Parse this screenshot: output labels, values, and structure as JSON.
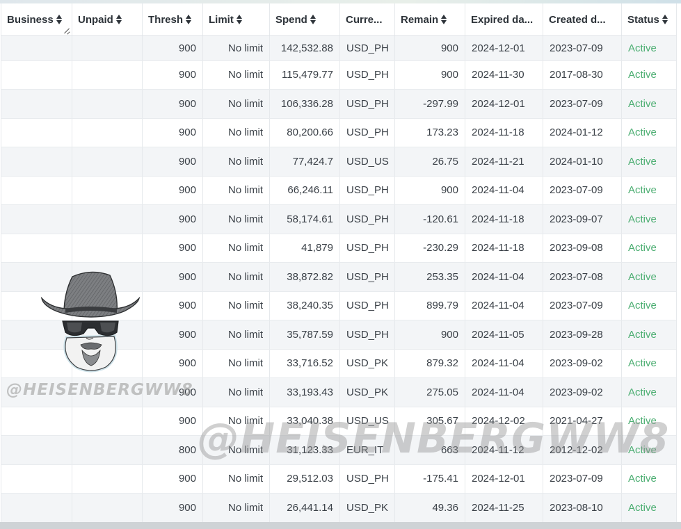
{
  "columns": [
    {
      "label": "Business",
      "name": "business"
    },
    {
      "label": "Unpaid",
      "name": "unpaid"
    },
    {
      "label": "Thresh",
      "name": "thresh"
    },
    {
      "label": "Limit",
      "name": "limit"
    },
    {
      "label": "Spend",
      "name": "spend"
    },
    {
      "label": "Curre...",
      "name": "currency"
    },
    {
      "label": "Remain",
      "name": "remain"
    },
    {
      "label": "Expired da...",
      "name": "expired-date"
    },
    {
      "label": "Created d...",
      "name": "created-date"
    },
    {
      "label": "Status",
      "name": "status"
    }
  ],
  "rows": [
    {
      "business": "",
      "unpaid": "",
      "thresh": "900",
      "limit": "No limit",
      "spend": "142,532.88",
      "currency": "USD_PH",
      "remain": "900",
      "expired": "2024-12-01",
      "created": "2023-07-09",
      "status": "Active"
    },
    {
      "business": "",
      "unpaid": "",
      "thresh": "900",
      "limit": "No limit",
      "spend": "115,479.77",
      "currency": "USD_PH",
      "remain": "900",
      "expired": "2024-11-30",
      "created": "2017-08-30",
      "status": "Active"
    },
    {
      "business": "",
      "unpaid": "",
      "thresh": "900",
      "limit": "No limit",
      "spend": "106,336.28",
      "currency": "USD_PH",
      "remain": "-297.99",
      "expired": "2024-12-01",
      "created": "2023-07-09",
      "status": "Active"
    },
    {
      "business": "",
      "unpaid": "",
      "thresh": "900",
      "limit": "No limit",
      "spend": "80,200.66",
      "currency": "USD_PH",
      "remain": "173.23",
      "expired": "2024-11-18",
      "created": "2024-01-12",
      "status": "Active"
    },
    {
      "business": "",
      "unpaid": "",
      "thresh": "900",
      "limit": "No limit",
      "spend": "77,424.7",
      "currency": "USD_US",
      "remain": "26.75",
      "expired": "2024-11-21",
      "created": "2024-01-10",
      "status": "Active"
    },
    {
      "business": "",
      "unpaid": "",
      "thresh": "900",
      "limit": "No limit",
      "spend": "66,246.11",
      "currency": "USD_PH",
      "remain": "900",
      "expired": "2024-11-04",
      "created": "2023-07-09",
      "status": "Active"
    },
    {
      "business": "",
      "unpaid": "",
      "thresh": "900",
      "limit": "No limit",
      "spend": "58,174.61",
      "currency": "USD_PH",
      "remain": "-120.61",
      "expired": "2024-11-18",
      "created": "2023-09-07",
      "status": "Active"
    },
    {
      "business": "",
      "unpaid": "",
      "thresh": "900",
      "limit": "No limit",
      "spend": "41,879",
      "currency": "USD_PH",
      "remain": "-230.29",
      "expired": "2024-11-18",
      "created": "2023-09-08",
      "status": "Active"
    },
    {
      "business": "",
      "unpaid": "",
      "thresh": "900",
      "limit": "No limit",
      "spend": "38,872.82",
      "currency": "USD_PH",
      "remain": "253.35",
      "expired": "2024-11-04",
      "created": "2023-07-08",
      "status": "Active"
    },
    {
      "business": "",
      "unpaid": "",
      "thresh": "900",
      "limit": "No limit",
      "spend": "38,240.35",
      "currency": "USD_PH",
      "remain": "899.79",
      "expired": "2024-11-04",
      "created": "2023-07-09",
      "status": "Active"
    },
    {
      "business": "",
      "unpaid": "",
      "thresh": "900",
      "limit": "No limit",
      "spend": "35,787.59",
      "currency": "USD_PH",
      "remain": "900",
      "expired": "2024-11-05",
      "created": "2023-09-28",
      "status": "Active"
    },
    {
      "business": "",
      "unpaid": "",
      "thresh": "900",
      "limit": "No limit",
      "spend": "33,716.52",
      "currency": "USD_PK",
      "remain": "879.32",
      "expired": "2024-11-04",
      "created": "2023-09-02",
      "status": "Active"
    },
    {
      "business": "",
      "unpaid": "",
      "thresh": "900",
      "limit": "No limit",
      "spend": "33,193.43",
      "currency": "USD_PK",
      "remain": "275.05",
      "expired": "2024-11-04",
      "created": "2023-09-02",
      "status": "Active"
    },
    {
      "business": "",
      "unpaid": "",
      "thresh": "900",
      "limit": "No limit",
      "spend": "33,040.38",
      "currency": "USD_US",
      "remain": "305.67",
      "expired": "2024-12-02",
      "created": "2021-04-27",
      "status": "Active"
    },
    {
      "business": "",
      "unpaid": "",
      "thresh": "800",
      "limit": "No limit",
      "spend": "31,123.33",
      "currency": "EUR_IT",
      "remain": "663",
      "expired": "2024-11-12",
      "created": "2012-12-02",
      "status": "Active"
    },
    {
      "business": "",
      "unpaid": "",
      "thresh": "900",
      "limit": "No limit",
      "spend": "29,512.03",
      "currency": "USD_PH",
      "remain": "-175.41",
      "expired": "2024-12-01",
      "created": "2023-07-09",
      "status": "Active"
    },
    {
      "business": "",
      "unpaid": "",
      "thresh": "900",
      "limit": "No limit",
      "spend": "26,441.14",
      "currency": "USD_PK",
      "remain": "49.36",
      "expired": "2024-11-25",
      "created": "2023-08-10",
      "status": "Active"
    }
  ],
  "watermark": {
    "small_text": "@HEISENBERGWW8",
    "large_text": "@HEISENBERGWW8",
    "avatar_icon": "hat-sunglasses-face-icon"
  },
  "colors": {
    "status_active": "#4cae72",
    "row_alt": "#f3f5f7",
    "header_text": "#2d3339"
  }
}
